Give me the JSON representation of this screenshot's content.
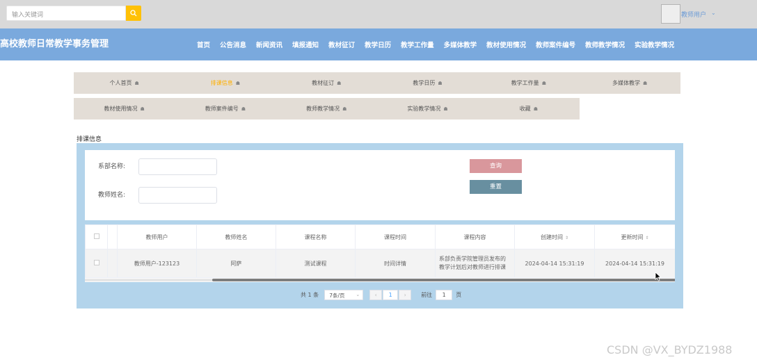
{
  "topbar": {
    "search_placeholder": "输入关键词",
    "user_label": "教师用户",
    "user_caret": "⌄"
  },
  "navbar": {
    "title": "高校教师日常教学事务管理",
    "items": [
      "首页",
      "公告消息",
      "新闻资讯",
      "填报通知",
      "教材征订",
      "教学日历",
      "教学工作量",
      "多媒体教学",
      "教材使用情况",
      "教师案件编号",
      "教师教学情况",
      "实验教学情况"
    ]
  },
  "tabs_row1": [
    "个人首页",
    "排课信息",
    "教材征订",
    "教学日历",
    "教学工作量",
    "多媒体教学"
  ],
  "tabs_row2": [
    "教材使用情况",
    "教师案件编号",
    "教师教学情况",
    "实验教学情况",
    "收藏"
  ],
  "active_tab": "排课信息",
  "section": {
    "title": "排课信息"
  },
  "search_form": {
    "department_label": "系部名称:",
    "teacher_label": "教师姓名:",
    "query_button": "查询",
    "reset_button": "重置"
  },
  "table": {
    "columns": [
      "教师用户",
      "教师姓名",
      "课程名称",
      "课程时间",
      "课程内容",
      "创建时间",
      "更新时间"
    ],
    "rows": [
      [
        "教师用户-123123",
        "阿萨",
        "测试课程",
        "时间详情",
        "系部负责学院管理员发布的教学计划后对教师进行排课",
        "2024-04-14 15:31:19",
        "2024-04-14 15:31:19"
      ]
    ]
  },
  "pagination": {
    "total": "共 1 条",
    "page_size": "7条/页",
    "current_page": "1",
    "goto_label": "前往",
    "goto_value": "1",
    "page_unit": "页"
  },
  "watermark": "CSDN @VX_BYDZ1988",
  "colors": {
    "topbar": "#d9d9d9",
    "navbar": "#7aa9dd",
    "search_button": "#ffc107",
    "active_tab": "#ffb000",
    "panel": "#b3d4eb",
    "query_button": "#d9979c",
    "reset_button": "#688fa0"
  }
}
